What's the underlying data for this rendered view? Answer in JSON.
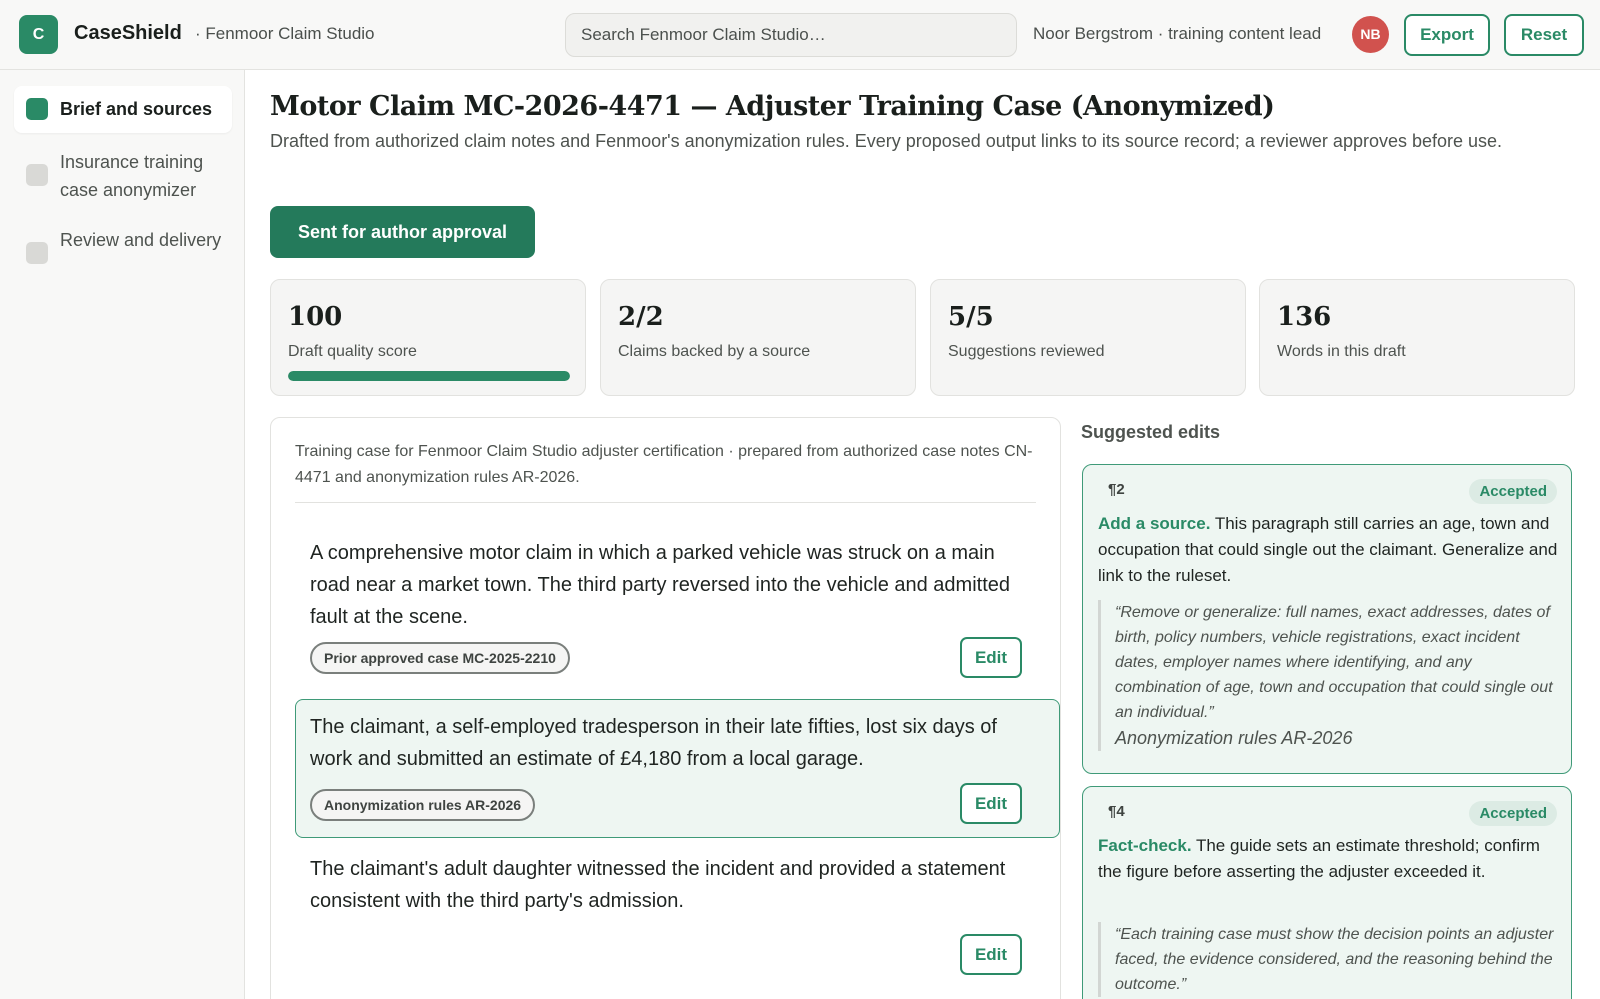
{
  "header": {
    "logo_letter": "C",
    "app_name": "CaseShield",
    "workspace": "· Fenmoor Claim Studio",
    "search_placeholder": "Search Fenmoor Claim Studio…",
    "user": "Noor Bergstrom · training content lead",
    "avatar_initials": "NB",
    "export_label": "Export",
    "reset_label": "Reset"
  },
  "sidebar": {
    "items": [
      {
        "label": "Brief and sources",
        "active": true
      },
      {
        "label": "Insurance training case anonymizer",
        "active": false
      },
      {
        "label": "Review and delivery",
        "active": false
      }
    ]
  },
  "main": {
    "title": "Motor Claim MC-2026-4471 — Adjuster Training Case (Anonymized)",
    "description": "Drafted from authorized claim notes and Fenmoor's anonymization rules. Every proposed output links to its source record; a reviewer approves before use.",
    "primary_button": "Sent for author approval",
    "stats": [
      {
        "value": "100",
        "label": "Draft quality score",
        "progress": 1.0
      },
      {
        "value": "2/2",
        "label": "Claims backed by a source"
      },
      {
        "value": "5/5",
        "label": "Suggestions reviewed"
      },
      {
        "value": "136",
        "label": "Words in this draft"
      }
    ]
  },
  "draft": {
    "intro": "Training case for Fenmoor Claim Studio adjuster certification · prepared from authorized case notes CN-4471 and anonymization rules AR-2026.",
    "paragraphs": [
      {
        "text": "A comprehensive motor claim in which a parked vehicle was struck on a main road near a market town. The third party reversed into the vehicle and admitted fault at the scene.",
        "source": "Prior approved case MC-2025-2210",
        "edit_label": "Edit"
      },
      {
        "text": "The claimant, a self-employed tradesperson in their late fifties, lost six days of work and submitted an estimate of £4,180 from a local garage.",
        "source": "Anonymization rules AR-2026",
        "edit_label": "Edit"
      },
      {
        "text": "The claimant's adult daughter witnessed the incident and provided a statement consistent with the third party's admission.",
        "source": "",
        "edit_label": "Edit"
      }
    ]
  },
  "suggestions": {
    "heading": "Suggested edits",
    "items": [
      {
        "para": "¶2",
        "status": "Accepted",
        "kind": "Add a source.",
        "text": "This paragraph still carries an age, town and occupation that could single out the claimant. Generalize and link to the ruleset.",
        "quote": "“Remove or generalize: full names, exact addresses, dates of birth, policy numbers, vehicle registrations, exact incident dates, employer names where identifying, and any combination of age, town and occupation that could single out an individual.”",
        "quote_source": "Anonymization rules AR-2026"
      },
      {
        "para": "¶4",
        "status": "Accepted",
        "kind": "Fact-check.",
        "text": "The guide sets an estimate threshold; confirm the figure before asserting the adjuster exceeded it.",
        "quote": "“Each training case must show the decision points an adjuster faced, the evidence considered, and the reasoning behind the outcome.”",
        "quote_source": ""
      }
    ]
  },
  "colors": {
    "accent": "#2a8a66",
    "primary_button": "#247a5b",
    "avatar": "#d1524e",
    "highlight_bg": "#eef6f2"
  }
}
